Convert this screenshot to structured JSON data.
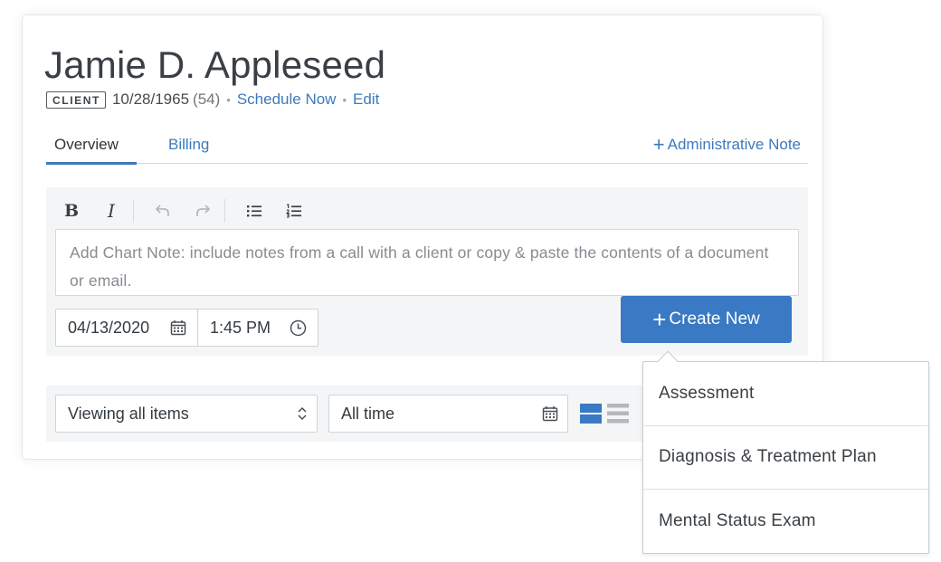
{
  "client": {
    "name": "Jamie D. Appleseed",
    "badge": "CLIENT",
    "dob": "10/28/1965",
    "age": "(54)",
    "schedule_link": "Schedule Now",
    "edit_link": "Edit",
    "separator": "•"
  },
  "tabs": [
    {
      "label": "Overview",
      "active": true
    },
    {
      "label": "Billing",
      "active": false
    }
  ],
  "admin_note": {
    "icon": "plus-icon",
    "label": "Administrative Note"
  },
  "editor": {
    "toolbar": [
      {
        "name": "bold",
        "glyph": "B",
        "icon": "bold-icon"
      },
      {
        "name": "italic",
        "glyph": "I",
        "icon": "italic-icon"
      },
      {
        "name": "undo",
        "icon": "undo-icon",
        "disabled": true
      },
      {
        "name": "redo",
        "icon": "redo-icon",
        "disabled": true
      },
      {
        "name": "bullet-list",
        "icon": "bullet-list-icon"
      },
      {
        "name": "numbered-list",
        "icon": "numbered-list-icon"
      }
    ],
    "placeholder": "Add Chart Note: include notes from a call with a client or copy & paste the contents of a document or email.",
    "date": "04/13/2020",
    "time": "1:45 PM"
  },
  "create_button": {
    "icon": "plus-icon",
    "label": "Create New"
  },
  "dropdown": {
    "items": [
      "Assessment",
      "Diagnosis & Treatment Plan",
      "Mental Status Exam"
    ]
  },
  "filters": {
    "items_select": "Viewing all items",
    "date_range": "All time",
    "view_modes": [
      "expanded-view-icon",
      "list-view-icon"
    ]
  },
  "colors": {
    "accent": "#3d7abb",
    "button": "#3a79c3",
    "panel": "#f4f5f6",
    "border": "#d0d4d7"
  }
}
